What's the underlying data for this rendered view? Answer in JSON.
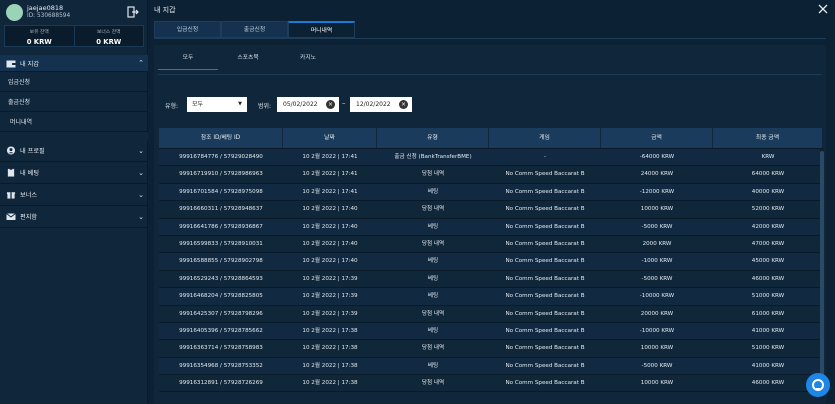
{
  "user": {
    "name": "jaejae0818",
    "id_text": "ID: 530688594",
    "balance_label": "보유 잔액",
    "balance_value": "0 KRW",
    "bonus_label": "보너스 잔액",
    "bonus_value": "0 KRW"
  },
  "sidebar": {
    "my_wallet": "내 지갑",
    "deposit": "입금신청",
    "withdraw": "출금신청",
    "money_history": "머니내역",
    "my_profile": "내 프로필",
    "my_betting": "내 베팅",
    "bonus": "보너스",
    "inbox": "편지함"
  },
  "page": {
    "title": "내 지갑"
  },
  "tabs": {
    "deposit": "입금신청",
    "withdraw": "출금신청",
    "money_history": "머니내역"
  },
  "subtabs": {
    "all": "모두",
    "sports": "스포츠북",
    "casino": "카지노"
  },
  "filters": {
    "type_label": "유형:",
    "type_value": "모두",
    "range_label": "범위:",
    "date_from": "05/02/2022",
    "date_to": "12/02/2022",
    "dash": "–"
  },
  "table": {
    "headers": [
      "참조 ID/베팅 ID",
      "날짜",
      "유형",
      "게임",
      "금액",
      "최종 금액"
    ],
    "rows": [
      [
        "99916784776 / 57929028490",
        "10 2월 2022 | 17:41",
        "출금 신청 (BankTransferBME)",
        "-",
        "-64000 KRW",
        "KRW"
      ],
      [
        "99916719910 / 57928986963",
        "10 2월 2022 | 17:41",
        "당첨 내역",
        "No Comm Speed Baccarat B",
        "24000 KRW",
        "64000 KRW"
      ],
      [
        "99916701584 / 57928975098",
        "10 2월 2022 | 17:41",
        "베팅",
        "No Comm Speed Baccarat B",
        "-12000 KRW",
        "40000 KRW"
      ],
      [
        "99916660311 / 57928948637",
        "10 2월 2022 | 17:40",
        "당첨 내역",
        "No Comm Speed Baccarat B",
        "10000 KRW",
        "52000 KRW"
      ],
      [
        "99916641786 / 57928936867",
        "10 2월 2022 | 17:40",
        "베팅",
        "No Comm Speed Baccarat B",
        "-5000 KRW",
        "42000 KRW"
      ],
      [
        "99916599833 / 57928910031",
        "10 2월 2022 | 17:40",
        "당첨 내역",
        "No Comm Speed Baccarat B",
        "2000 KRW",
        "47000 KRW"
      ],
      [
        "99916588855 / 57928902798",
        "10 2월 2022 | 17:40",
        "베팅",
        "No Comm Speed Baccarat B",
        "-1000 KRW",
        "45000 KRW"
      ],
      [
        "99916529243 / 57928864593",
        "10 2월 2022 | 17:39",
        "베팅",
        "No Comm Speed Baccarat B",
        "-5000 KRW",
        "46000 KRW"
      ],
      [
        "99916468204 / 57928825805",
        "10 2월 2022 | 17:39",
        "베팅",
        "No Comm Speed Baccarat B",
        "-10000 KRW",
        "51000 KRW"
      ],
      [
        "99916425307 / 57928798296",
        "10 2월 2022 | 17:39",
        "당첨 내역",
        "No Comm Speed Baccarat B",
        "20000 KRW",
        "61000 KRW"
      ],
      [
        "99916405396 / 57928785662",
        "10 2월 2022 | 17:38",
        "베팅",
        "No Comm Speed Baccarat B",
        "-10000 KRW",
        "41000 KRW"
      ],
      [
        "99916363714 / 57928758983",
        "10 2월 2022 | 17:38",
        "당첨 내역",
        "No Comm Speed Baccarat B",
        "10000 KRW",
        "51000 KRW"
      ],
      [
        "99916354968 / 57928753352",
        "10 2월 2022 | 17:38",
        "베팅",
        "No Comm Speed Baccarat B",
        "-5000 KRW",
        "41000 KRW"
      ],
      [
        "99916312891 / 57928726269",
        "10 2월 2022 | 17:38",
        "당첨 내역",
        "No Comm Speed Baccarat B",
        "10000 KRW",
        "46000 KRW"
      ]
    ]
  },
  "colors": {
    "accent": "#1b7ad3",
    "background": "#0d2134",
    "chat": "#1e86e6"
  }
}
